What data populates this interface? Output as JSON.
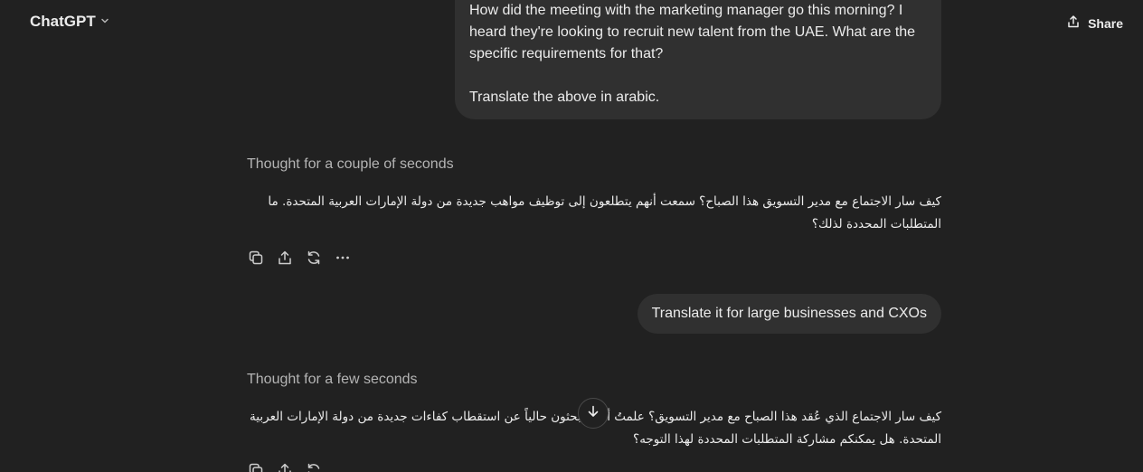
{
  "header": {
    "model_label": "ChatGPT",
    "share_label": "Share"
  },
  "conversation": {
    "user_message_1": {
      "line_1": "How did the meeting with the marketing manager go this morning? I heard they're looking to recruit new talent from the UAE. What are the specific requirements for that?",
      "line_2": "Translate the above in arabic."
    },
    "thought_1": "Thought for a couple of seconds",
    "assistant_message_1": "كيف سار الاجتماع مع مدير التسويق هذا الصباح؟ سمعت أنهم يتطلعون إلى توظيف مواهب جديدة من دولة الإمارات العربية المتحدة. ما المتطلبات المحددة لذلك؟",
    "user_message_2": "Translate it for large businesses and CXOs",
    "thought_2": "Thought for a few seconds",
    "assistant_message_2": "كيف سار الاجتماع الذي عُقد هذا الصباح مع مدير التسويق؟ علمتُ أنكم تبحثون حالياً عن استقطاب كفاءات جديدة من دولة الإمارات العربية المتحدة. هل يمكنكم مشاركة المتطلبات المحددة لهذا التوجه؟"
  },
  "icons": {
    "model_chevron": "chevron-down-icon",
    "share": "share-icon",
    "copy": "copy-icon",
    "export": "share-icon",
    "regenerate": "regenerate-icon",
    "more": "more-icon",
    "scroll_down": "arrow-down-icon"
  }
}
